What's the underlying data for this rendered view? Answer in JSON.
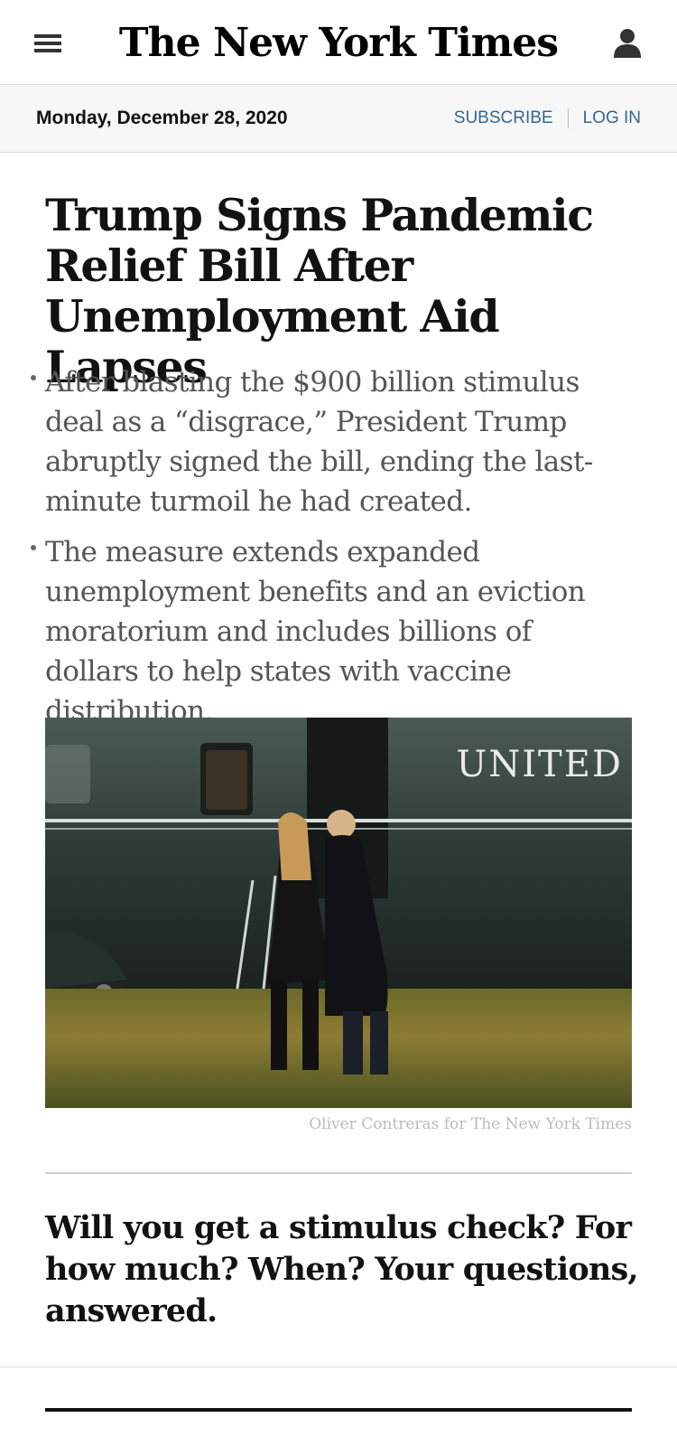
{
  "header": {
    "logo_text": "The New York Times",
    "menu_icon": "hamburger-menu-icon",
    "account_icon": "user-account-icon"
  },
  "datebar": {
    "date": "Monday, December 28, 2020",
    "subscribe_label": "SUBSCRIBE",
    "login_label": "LOG IN"
  },
  "article": {
    "headline": "Trump Signs Pandemic Relief Bill After Unemployment Aid Lapses",
    "summary": [
      "After blasting the $900 billion stimulus deal as a “disgrace,” President Trump abruptly signed the bill, ending the last-minute turmoil he had created.",
      "The measure extends expanded unemployment benefits and an eviction moratorium and includes billions of dollars to help states with vaccine distribution."
    ],
    "photo": {
      "visible_text": "UNITED",
      "credit": "Oliver Contreras for The New York Times"
    }
  },
  "related": {
    "headline": "Will you get a stimulus check? For how much? When? Your questions, answered."
  },
  "colors": {
    "link": "#326891",
    "text": "#121212",
    "summary_text": "#555555",
    "datebar_bg": "#f7f7f7",
    "credit": "#bbbbbb"
  }
}
